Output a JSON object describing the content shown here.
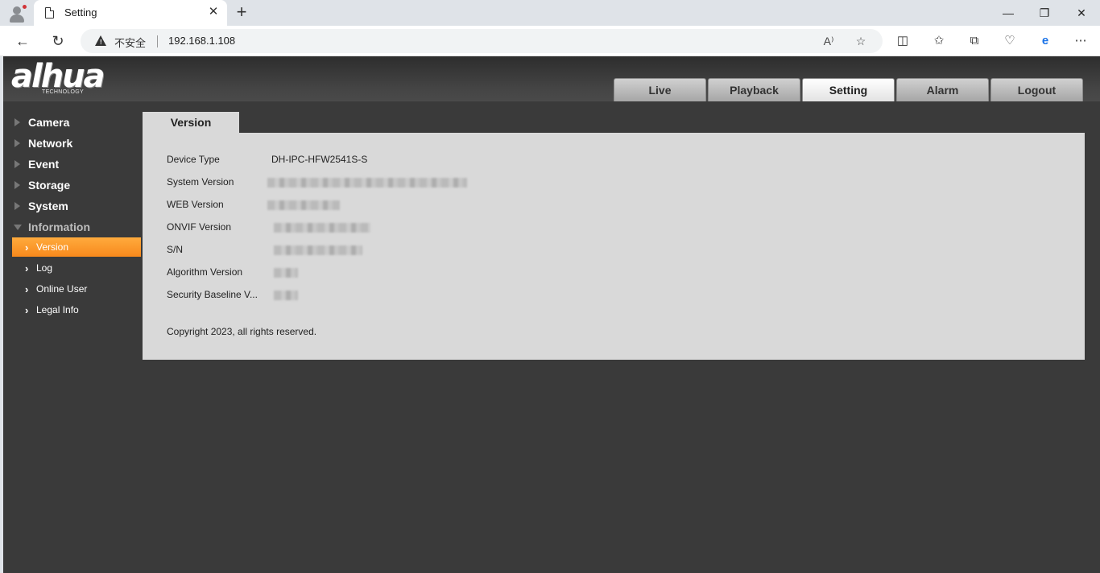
{
  "browser": {
    "tab_title": "Setting",
    "tab_close": "✕",
    "new_tab": "+",
    "security_label": "不安全",
    "url": "192.168.1.108",
    "window_controls": {
      "minimize": "—",
      "restore": "❐",
      "close": "✕"
    },
    "icons": [
      "back-arrow-icon",
      "refresh-icon",
      "read-aloud-icon",
      "favorite-star-icon",
      "split-screen-icon",
      "favorites-icon",
      "collections-icon",
      "performance-icon",
      "edge-icon",
      "more-icon"
    ]
  },
  "app": {
    "logo": "alhua",
    "logo_sub": "TECHNOLOGY",
    "main_tabs": [
      {
        "label": "Live",
        "active": false
      },
      {
        "label": "Playback",
        "active": false
      },
      {
        "label": "Setting",
        "active": true
      },
      {
        "label": "Alarm",
        "active": false
      },
      {
        "label": "Logout",
        "active": false
      }
    ],
    "sidebar": {
      "items": [
        {
          "label": "Camera"
        },
        {
          "label": "Network"
        },
        {
          "label": "Event"
        },
        {
          "label": "Storage"
        },
        {
          "label": "System"
        },
        {
          "label": "Information",
          "expanded": true
        }
      ],
      "sub_items": [
        {
          "label": "Version",
          "active": true
        },
        {
          "label": "Log"
        },
        {
          "label": "Online User"
        },
        {
          "label": "Legal Info"
        }
      ]
    },
    "content": {
      "tab_label": "Version",
      "fields": [
        {
          "label": "Device Type",
          "value": "DH-IPC-HFW2541S-S"
        },
        {
          "label": "System Version",
          "value": ""
        },
        {
          "label": "WEB Version",
          "value": ""
        },
        {
          "label": "ONVIF Version",
          "value": ""
        },
        {
          "label": "S/N",
          "value": ""
        },
        {
          "label": "Algorithm Version",
          "value": ""
        },
        {
          "label": "Security Baseline V...",
          "value": ""
        }
      ],
      "copyright": "Copyright 2023, all rights reserved."
    }
  },
  "colors": {
    "accent_orange": "#f7891c",
    "page_background": "#3a3a3a",
    "panel_background": "#d9d9d9"
  }
}
